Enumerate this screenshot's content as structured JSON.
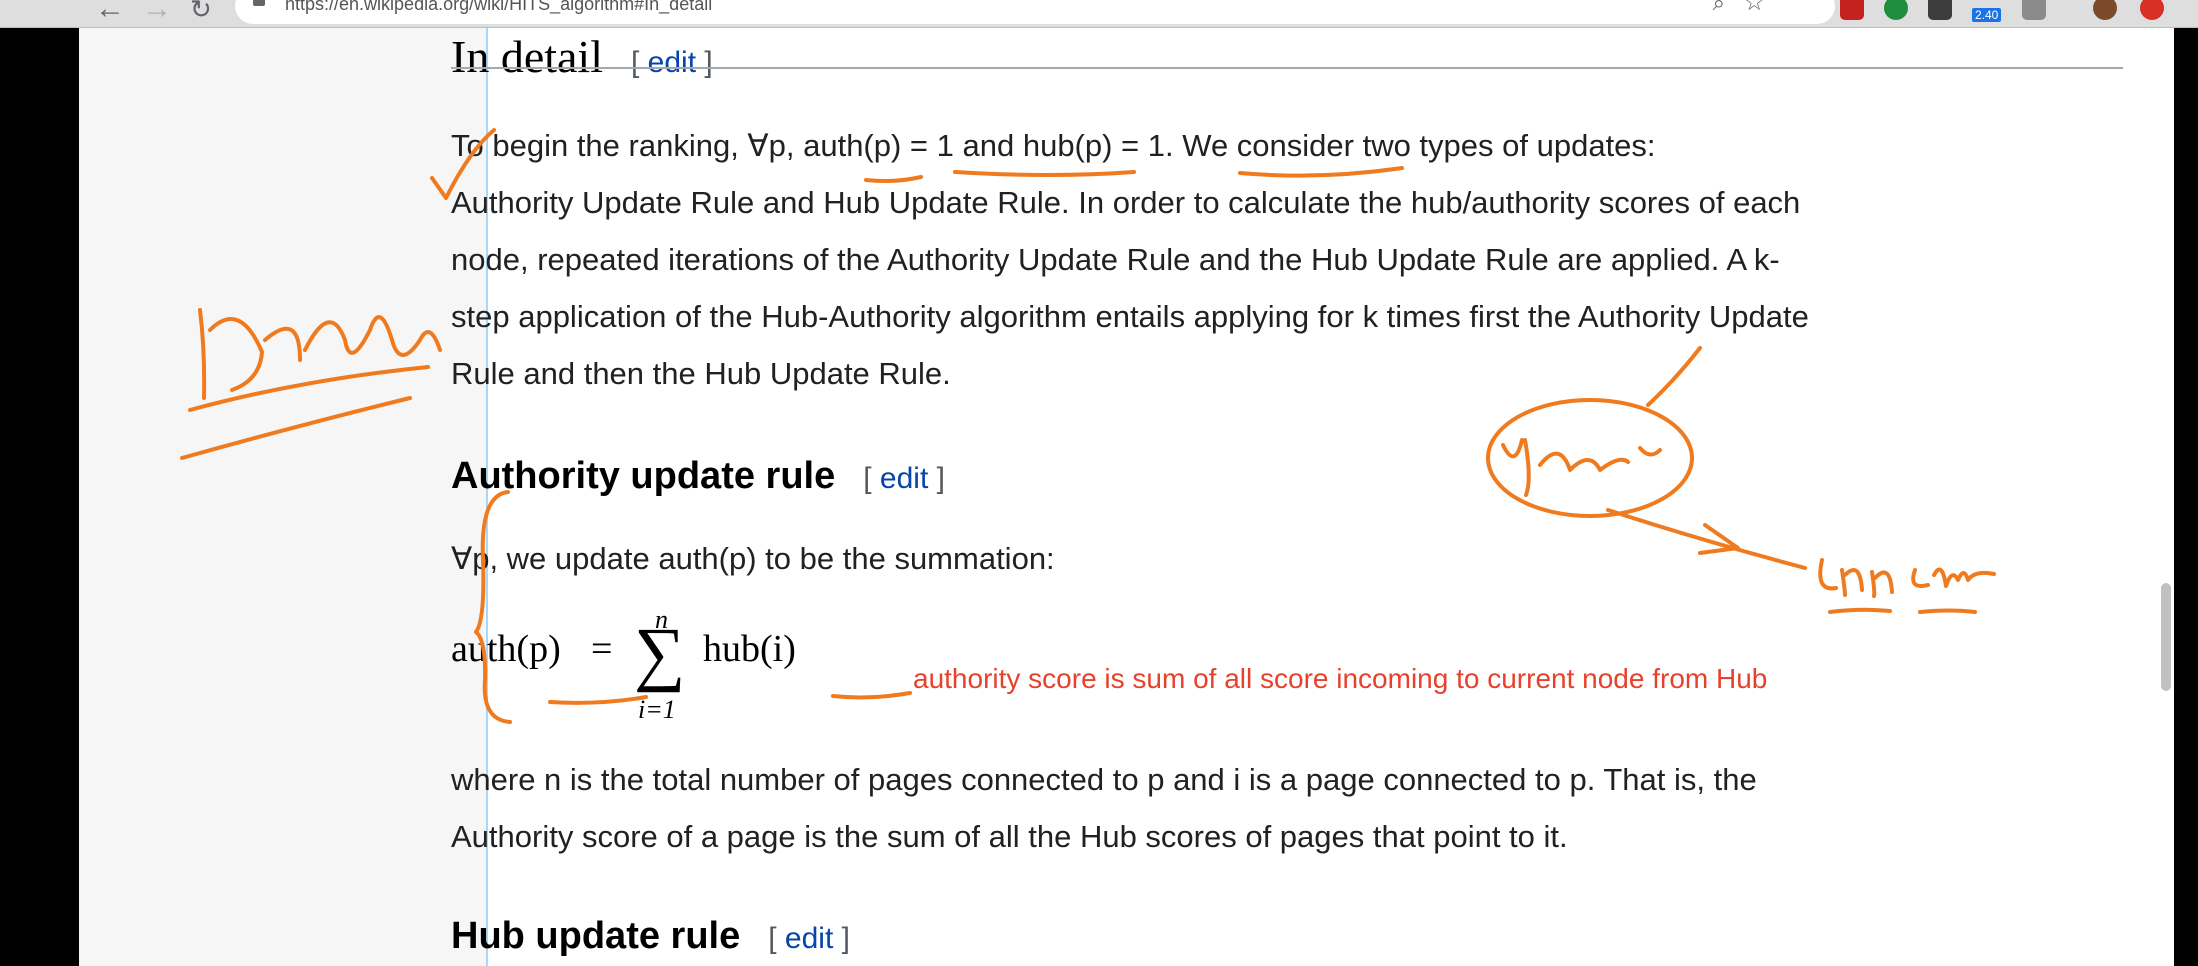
{
  "browser": {
    "url": "https://en.wikipedia.org/wiki/HITS_algorithm#In_detail",
    "badge": "2.40"
  },
  "article": {
    "section_title": "In detail",
    "edit_label": "edit",
    "intro_lines": [
      "To begin the ranking, ∀p, auth(p) = 1 and hub(p) = 1. We consider two types of updates:",
      "Authority Update Rule and Hub Update Rule. In order to calculate the hub/authority scores of each",
      "node, repeated iterations of the Authority Update Rule and the Hub Update Rule are applied. A k-",
      "step application of the Hub-Authority algorithm entails applying for k times first the Authority Update",
      "Rule and then the Hub Update Rule."
    ],
    "authority_title": "Authority update rule",
    "authority_intro": "∀p, we update auth(p) to be the summation:",
    "formula": {
      "lhs": "auth(p)",
      "eq": "=",
      "upper": "n",
      "lower": "i=1",
      "sigma": "∑",
      "rhs": "hub(i)"
    },
    "authority_desc": [
      "where n is the total number of pages connected to p and i is a page connected to p. That is, the",
      "Authority score of a page is the sum of all the Hub scores of pages that point to it."
    ],
    "hub_title": "Hub update rule"
  },
  "annotations": {
    "note": "authority score is sum of all score incoming to current node from Hub",
    "ink_color": "#f07a1e",
    "note_color": "#e8412b"
  }
}
